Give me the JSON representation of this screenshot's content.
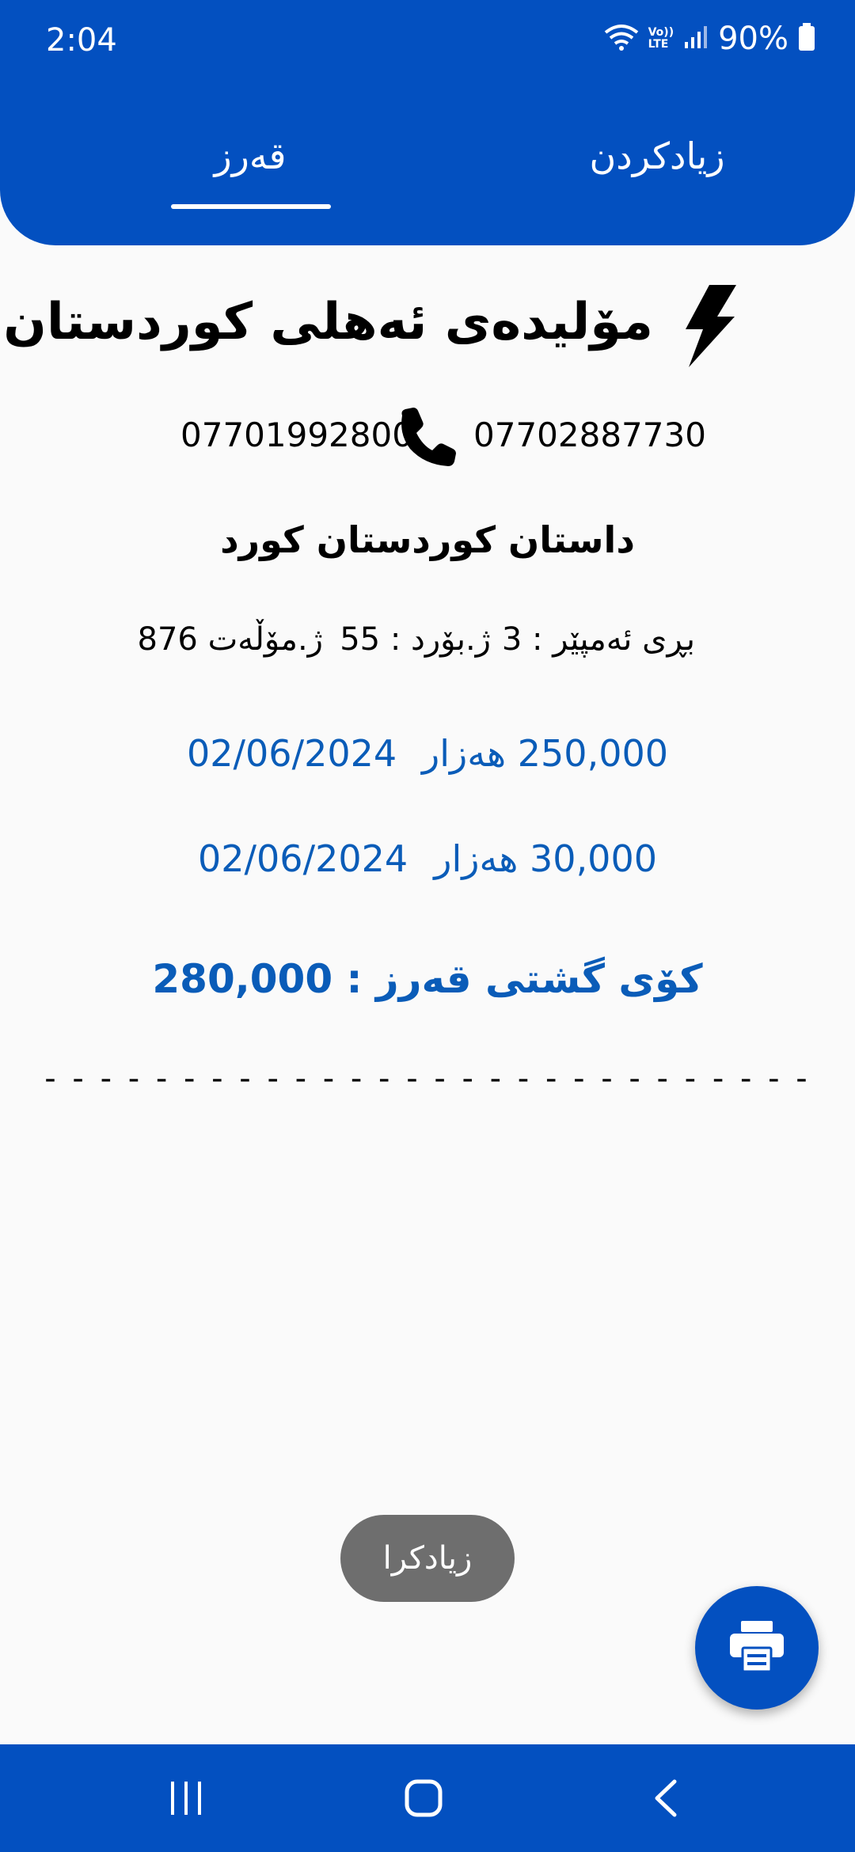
{
  "status_bar": {
    "time": "2:04",
    "battery": "90%",
    "volte_line1": "Vo))",
    "volte_line2": "LTE"
  },
  "tabs": {
    "debt": "قەرز",
    "add": "زیادکردن",
    "active": "debt"
  },
  "generator": {
    "name": "مۆلیدەی ئەهلی کوردستان",
    "icon": "lightning-icon"
  },
  "phones": {
    "left": "07701992800",
    "right": "07702887730"
  },
  "customer": "داستان کوردستان کورد",
  "meters": {
    "ampere": "بڕی ئەمپێر : 3",
    "board": "ژ.بۆرد : 55",
    "permit": "ژ.مۆڵەت 876"
  },
  "entries": [
    {
      "amount": "250,000 هەزار",
      "date": "02/06/2024"
    },
    {
      "amount": "30,000 هەزار",
      "date": "02/06/2024"
    }
  ],
  "total": "کۆی گشتی قەرز : 280,000",
  "divider": "- - - - - - - - - - - - - - - - - - - - - - - - - - - -",
  "toast": "زیادکرا",
  "fab_icon": "printer-icon",
  "colors": {
    "primary": "#0350c0",
    "accent_text": "#0a5cb8",
    "toast_bg": "#6e6e6e"
  }
}
